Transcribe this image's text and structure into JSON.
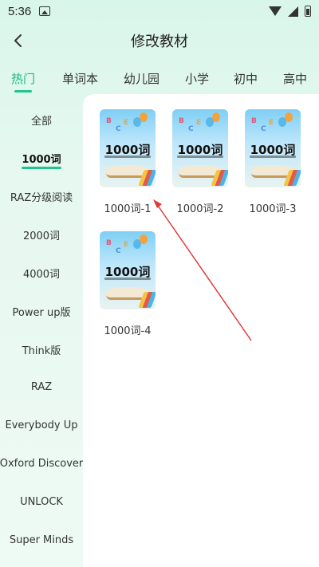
{
  "status_bar": {
    "time": "5:36"
  },
  "header": {
    "title": "修改教材"
  },
  "tabs": [
    {
      "label": "热门",
      "active": true
    },
    {
      "label": "单词本"
    },
    {
      "label": "幼儿园"
    },
    {
      "label": "小学"
    },
    {
      "label": "初中"
    },
    {
      "label": "高中"
    }
  ],
  "sidebar": {
    "items": [
      {
        "label": "全部"
      },
      {
        "label": "1000词",
        "active": true
      },
      {
        "label": "RAZ分级阅读"
      },
      {
        "label": "2000词"
      },
      {
        "label": "4000词"
      },
      {
        "label": "Power up版"
      },
      {
        "label": "Think版"
      },
      {
        "label": "RAZ"
      },
      {
        "label": "Everybody Up"
      },
      {
        "label": "Oxford Discover"
      },
      {
        "label": "UNLOCK"
      },
      {
        "label": "Super Minds"
      }
    ]
  },
  "books": [
    {
      "cover_title": "1000词",
      "label": "1000词-1"
    },
    {
      "cover_title": "1000词",
      "label": "1000词-2"
    },
    {
      "cover_title": "1000词",
      "label": "1000词-3"
    },
    {
      "cover_title": "1000词",
      "label": "1000词-4"
    }
  ],
  "colors": {
    "accent": "#22c48a",
    "arrow": "#e03a3a"
  }
}
